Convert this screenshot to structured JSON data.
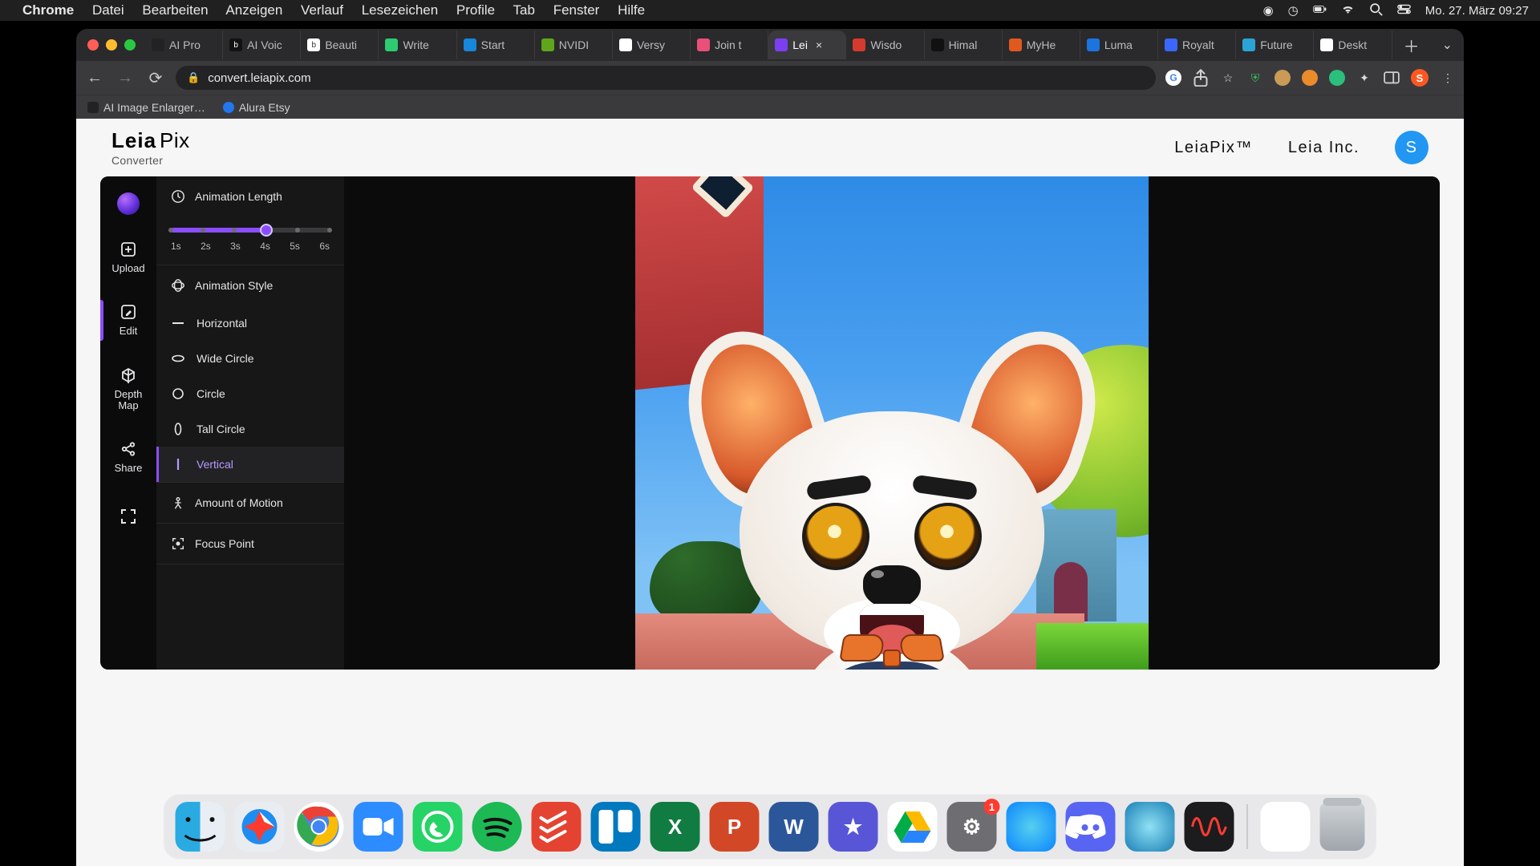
{
  "menubar": {
    "app": "Chrome",
    "items": [
      "Datei",
      "Bearbeiten",
      "Anzeigen",
      "Verlauf",
      "Lesezeichen",
      "Profile",
      "Tab",
      "Fenster",
      "Hilfe"
    ],
    "clock": "Mo. 27. März  09:27"
  },
  "tabs": [
    {
      "label": "AI Pro",
      "fav_bg": "#222",
      "fav_text": ""
    },
    {
      "label": "AI Voic",
      "fav_bg": "#111",
      "fav_text": "b"
    },
    {
      "label": "Beauti",
      "fav_bg": "#fff",
      "fav_text": "b"
    },
    {
      "label": "Write",
      "fav_bg": "#2ecc71",
      "fav_text": ""
    },
    {
      "label": "Start",
      "fav_bg": "#1687d9",
      "fav_text": ""
    },
    {
      "label": "NVIDI",
      "fav_bg": "#5fa61c",
      "fav_text": ""
    },
    {
      "label": "Versy",
      "fav_bg": "#fff",
      "fav_text": ""
    },
    {
      "label": "Join t",
      "fav_bg": "#e94f79",
      "fav_text": ""
    },
    {
      "label": "Lei",
      "fav_bg": "#7b3ff2",
      "fav_text": ""
    },
    {
      "label": "Wisdo",
      "fav_bg": "#d53a2e",
      "fav_text": ""
    },
    {
      "label": "Himal",
      "fav_bg": "#111",
      "fav_text": ""
    },
    {
      "label": "MyHe",
      "fav_bg": "#e0591f",
      "fav_text": ""
    },
    {
      "label": "Luma",
      "fav_bg": "#1c74e0",
      "fav_text": ""
    },
    {
      "label": "Royalt",
      "fav_bg": "#3a67ff",
      "fav_text": ""
    },
    {
      "label": "Future",
      "fav_bg": "#2aa4d6",
      "fav_text": ""
    },
    {
      "label": "Deskt",
      "fav_bg": "#fff",
      "fav_text": ""
    }
  ],
  "active_tab_index": 8,
  "addr": {
    "url": "convert.leiapix.com"
  },
  "bookmarks": [
    "AI Image Enlarger…",
    "Alura Etsy"
  ],
  "app": {
    "logo_leia": "Leia",
    "logo_pix": "Pix",
    "logo_sub": "Converter",
    "nav": [
      "LeiaPix™",
      "Leia Inc."
    ],
    "avatar": "S"
  },
  "vnav": {
    "upload": "Upload",
    "edit": "Edit",
    "depth": "Depth\nMap",
    "share": "Share"
  },
  "panel": {
    "anim_len": "Animation Length",
    "ticks": [
      "1s",
      "2s",
      "3s",
      "4s",
      "5s",
      "6s"
    ],
    "selected_tick_index": 3,
    "anim_style": "Animation Style",
    "styles": [
      "Horizontal",
      "Wide Circle",
      "Circle",
      "Tall Circle",
      "Vertical"
    ],
    "selected_style_index": 4,
    "amount": "Amount of Motion",
    "focus": "Focus Point"
  },
  "dock": {
    "settings_badge": "1",
    "apps": [
      {
        "name": "finder",
        "bg": "linear-gradient(#29abe2, #0071bc)",
        "glyph": ""
      },
      {
        "name": "safari",
        "bg": "linear-gradient(#f5f5f7, #cfd3d8)",
        "glyph": ""
      },
      {
        "name": "chrome",
        "bg": "#fff",
        "glyph": ""
      },
      {
        "name": "zoom",
        "bg": "#2d8cff",
        "glyph": ""
      },
      {
        "name": "whatsapp",
        "bg": "#25d366",
        "glyph": ""
      },
      {
        "name": "spotify",
        "bg": "#1db954",
        "glyph": ""
      },
      {
        "name": "todoist",
        "bg": "#e44332",
        "glyph": ""
      },
      {
        "name": "trello",
        "bg": "#0079bf",
        "glyph": ""
      },
      {
        "name": "excel",
        "bg": "#107c41",
        "glyph": "X"
      },
      {
        "name": "powerpoint",
        "bg": "#d24726",
        "glyph": "P"
      },
      {
        "name": "word",
        "bg": "#2b579a",
        "glyph": "W"
      },
      {
        "name": "imovie",
        "bg": "#5856d6",
        "glyph": "★"
      },
      {
        "name": "drive",
        "bg": "#fff",
        "glyph": ""
      },
      {
        "name": "settings",
        "bg": "#6e6e72",
        "glyph": "⚙"
      },
      {
        "name": "siri",
        "bg": "radial-gradient(circle at 50% 50%, #55d0ee, #0a84ff)",
        "glyph": ""
      },
      {
        "name": "discord",
        "bg": "#5865f2",
        "glyph": ""
      },
      {
        "name": "quicktime",
        "bg": "radial-gradient(circle at 50% 50%, #8fe1f5, #1b7fb5)",
        "glyph": ""
      },
      {
        "name": "voice-memos",
        "bg": "#1c1c1e",
        "glyph": ""
      }
    ]
  }
}
